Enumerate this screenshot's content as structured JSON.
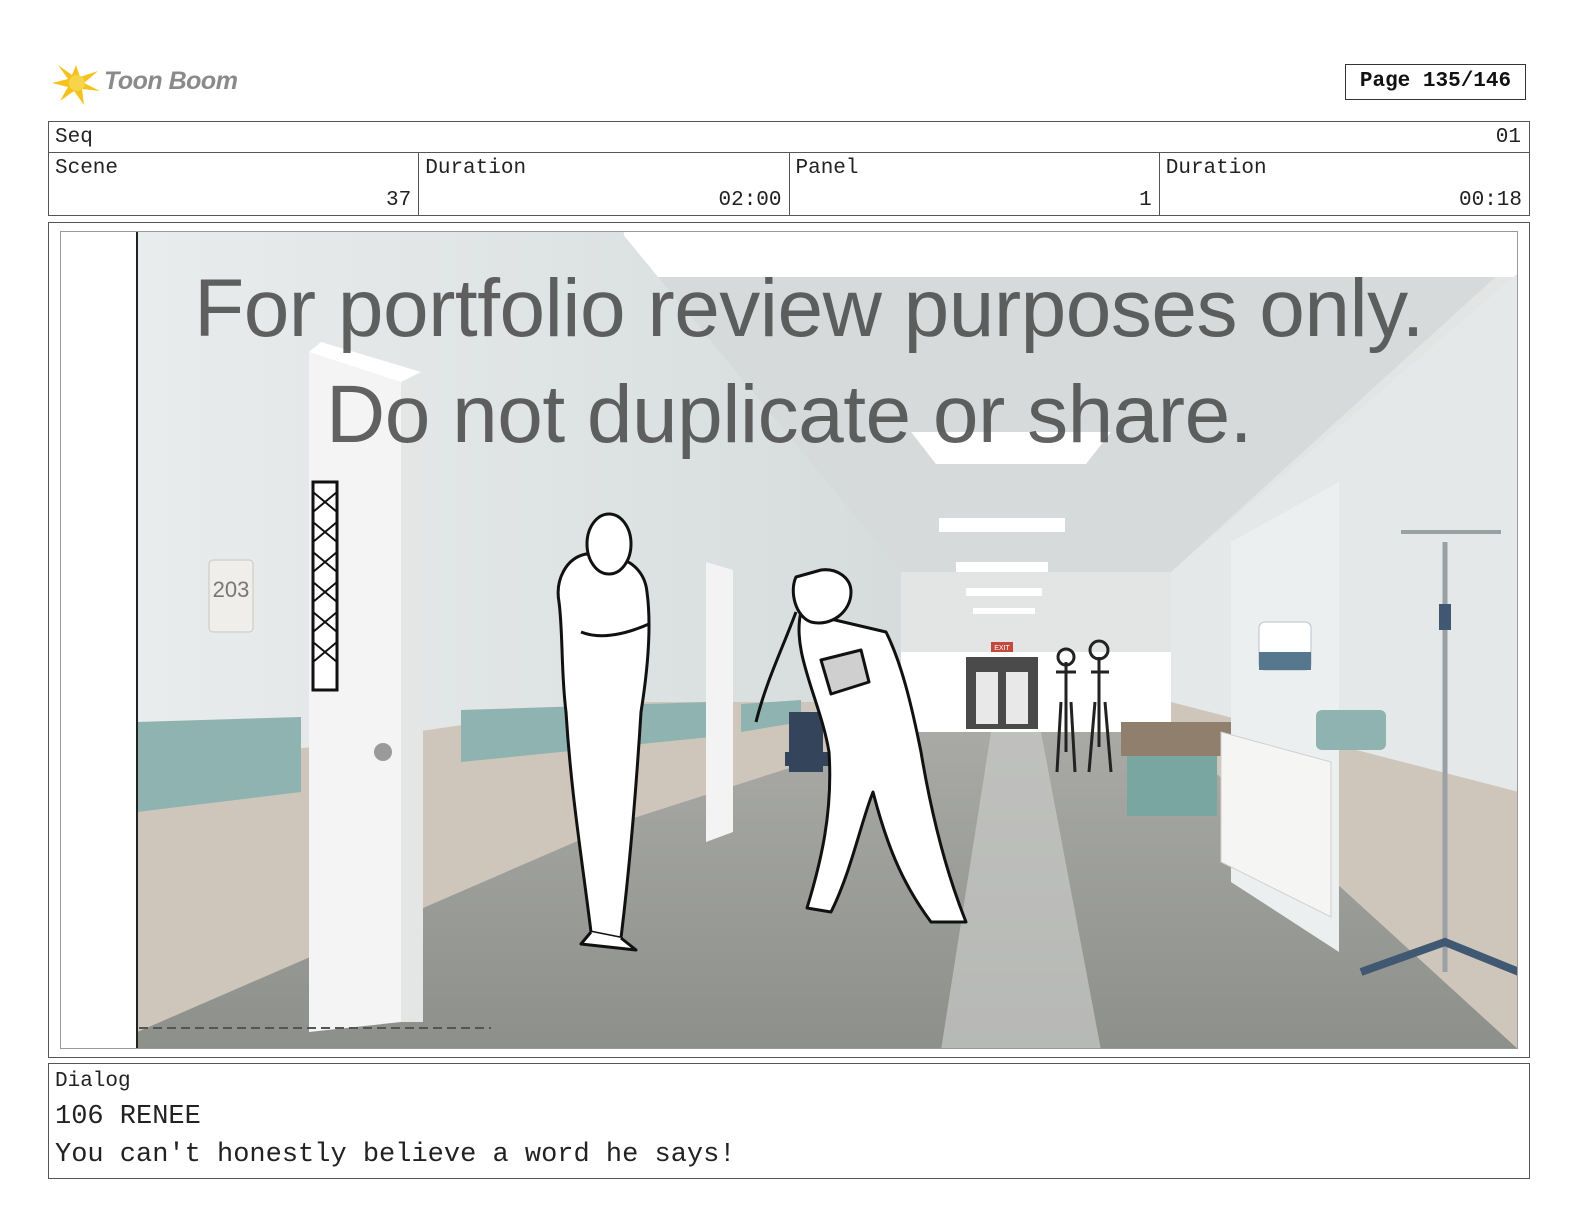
{
  "header": {
    "logo_text": "Toon Boom",
    "page_label": "Page 135/146"
  },
  "seq": {
    "label": "Seq",
    "value": "01"
  },
  "info": [
    {
      "label": "Scene",
      "value": "37"
    },
    {
      "label": "Duration",
      "value": "02:00"
    },
    {
      "label": "Panel",
      "value": "1"
    },
    {
      "label": "Duration",
      "value": "00:18"
    }
  ],
  "panel": {
    "watermark_line1": "For portfolio review purposes only.",
    "watermark_line2": "Do not duplicate or share.",
    "room_sign": "203",
    "exit_sign": "EXIT"
  },
  "dialog": {
    "label": "Dialog",
    "speaker": "106 RENEE",
    "line": "You can't honestly believe a word he says!"
  }
}
